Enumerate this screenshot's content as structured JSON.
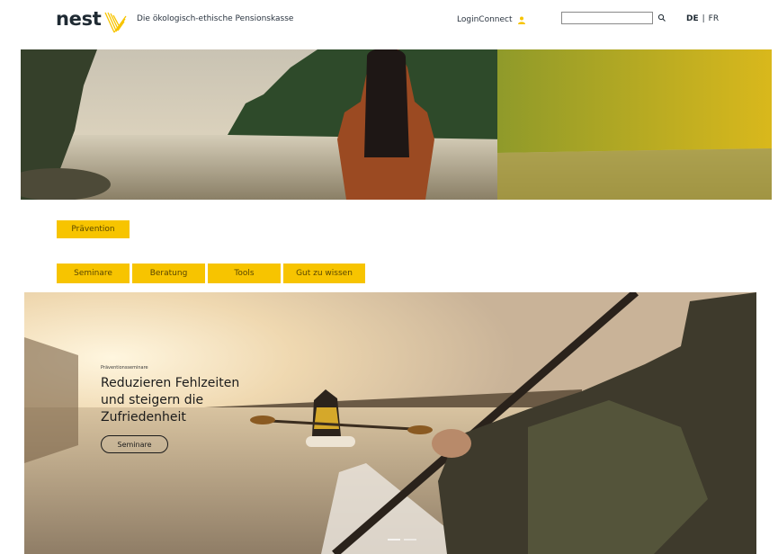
{
  "header": {
    "logo_text": "nest",
    "tagline": "Die ökologisch-ethische Pensionskasse",
    "login_label": "LoginConnect",
    "search": {
      "value": "",
      "placeholder": ""
    },
    "languages": {
      "current": "DE",
      "separator": "|",
      "other": "FR"
    }
  },
  "section": {
    "prevention_label": "Prävention"
  },
  "nav": {
    "items": [
      {
        "label": "Seminare"
      },
      {
        "label": "Beratung"
      },
      {
        "label": "Tools"
      },
      {
        "label": "Gut zu wissen"
      }
    ]
  },
  "banner": {
    "eyebrow": "Präventionsseminare",
    "headline": "Reduzieren Fehlzeiten und steigern die Zufriedenheit",
    "cta_label": "Seminare"
  },
  "colors": {
    "accent": "#f7c400",
    "text": "#1f2a33"
  }
}
